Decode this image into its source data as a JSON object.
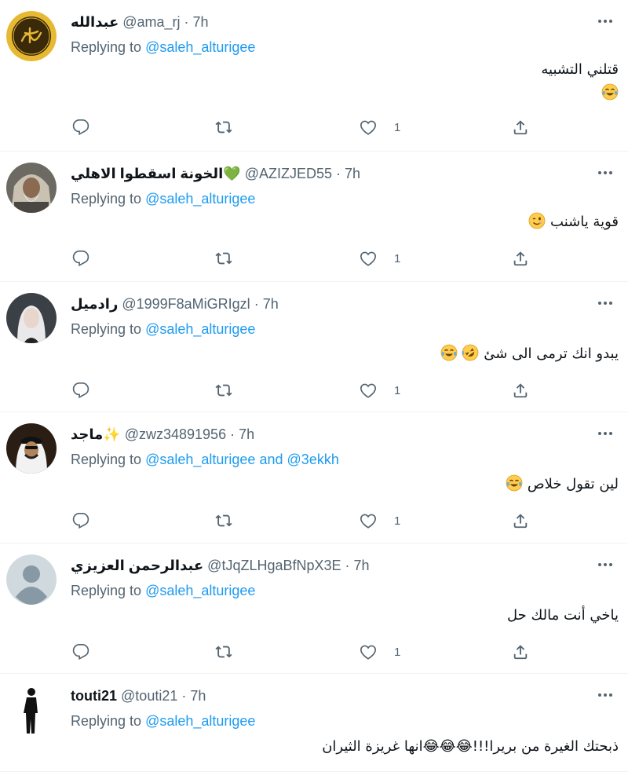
{
  "connector_mid": "·",
  "replying_prefix": "Replying to",
  "replying_and": "and",
  "replies": [
    {
      "name": "عبدالله",
      "handle": "@ama_rj",
      "time": "7h",
      "mentions": [
        "@saleh_alturigee"
      ],
      "text": "قتلني التشبيه",
      "emojis_line2": [
        "tears-of-joy"
      ],
      "like_count": "1",
      "avatar_icon": "calligraphy-avatar-icon",
      "avatar_colors": [
        "#e7b832",
        "#3a2a0a"
      ]
    },
    {
      "name": "الخونة اسقطوا الاهلي💚",
      "handle": "@AZIZJED55",
      "time": "7h",
      "mentions": [
        "@saleh_alturigee"
      ],
      "text": "قوية ياشنب",
      "emojis_inline": [
        "wink"
      ],
      "like_count": "1",
      "avatar_icon": "elder-portrait-avatar-icon",
      "avatar_colors": [
        "#6d6a63",
        "#c9c2b3"
      ]
    },
    {
      "name": "رادميل",
      "handle": "@1999F8aMiGRIgzl",
      "time": "7h",
      "mentions": [
        "@saleh_alturigee"
      ],
      "text": "يبدو انك ترمى الى شئ",
      "emojis_inline": [
        "rofl",
        "tears-of-joy"
      ],
      "like_count": "1",
      "avatar_icon": "woman-portrait-avatar-icon",
      "avatar_colors": [
        "#3b3f46",
        "#e9e9eb"
      ]
    },
    {
      "name": "ماجد✨",
      "handle": "@zwz34891956",
      "time": "7h",
      "mentions": [
        "@saleh_alturigee",
        "@3ekkh"
      ],
      "text": "لين تقول خلاص",
      "emojis_inline": [
        "tears-of-joy"
      ],
      "like_count": "1",
      "avatar_icon": "man-ghutra-avatar-icon",
      "avatar_colors": [
        "#2a1d14",
        "#f2f2f2"
      ]
    },
    {
      "name": "عبدالرحمن العزيزي",
      "handle": "@tJqZLHgaBfNpX3E",
      "time": "7h",
      "mentions": [
        "@saleh_alturigee"
      ],
      "text": "ياخي أنت مالك حل",
      "emojis_inline": [],
      "like_count": "1",
      "avatar_icon": "default-user-avatar-icon",
      "avatar_colors": [
        "#cfd9de",
        "#8899a6"
      ]
    },
    {
      "name": "touti21",
      "handle": "@touti21",
      "time": "7h",
      "mentions": [
        "@saleh_alturigee"
      ],
      "text": "ذبحتك الغيرة من بريرا!!!😂😂😂انها غريزة الثيران",
      "emojis_inline": [],
      "like_count": "",
      "avatar_icon": "silhouette-avatar-icon",
      "avatar_colors": [
        "#ffffff",
        "#111111"
      ]
    }
  ],
  "colors": {
    "link": "#1d9bf0",
    "secondary": "#536471",
    "divider": "#eff3f4"
  },
  "icons": [
    "reply-icon",
    "retweet-icon",
    "like-icon",
    "share-icon",
    "more-icon"
  ]
}
